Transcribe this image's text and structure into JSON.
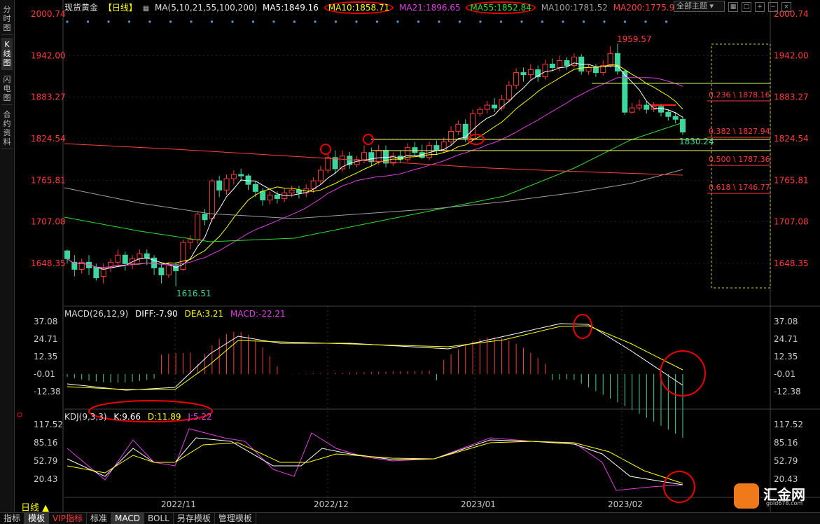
{
  "left_tabs": [
    "分时图",
    "K线图",
    "闪电图",
    "合约资料"
  ],
  "header": {
    "symbol": "现货黄金",
    "period": "【日线】",
    "ma_icon": "chart-icon",
    "ma_spec": "MA(5,10,21,55,100,200)",
    "ma5": "MA5:1849.16",
    "ma10": "MA10:1858.71",
    "ma21": "MA21:1896.65",
    "ma55": "MA55:1852.84",
    "ma100": "MA100:1781.52",
    "ma200": "MA200:1775.95",
    "theme": "全部主题",
    "colors": {
      "ma5": "#ffffff",
      "ma10": "#ffff00",
      "ma21": "#e040e0",
      "ma55": "#30e030",
      "ma100": "#a0a0a0",
      "ma200": "#ff4040"
    }
  },
  "price_axis": [
    "2000.74",
    "1942.00",
    "1883.27",
    "1824.54",
    "1765.81",
    "1707.08",
    "1648.35"
  ],
  "annotations": {
    "high": "1959.57",
    "low": "1616.51",
    "last": "1830.24"
  },
  "fib": [
    {
      "label": "0.236 \\ 1878.16"
    },
    {
      "label": "0.382 \\ 1827.94"
    },
    {
      "label": "0.500 \\ 1787.36"
    },
    {
      "label": "0.618 \\ 1746.77"
    }
  ],
  "macd": {
    "title": "MACD(26,12,9)",
    "diff": "DIFF:-7.90",
    "dea": "DEA:3.21",
    "macd": "MACD:-22.21",
    "axis": [
      "37.08",
      "24.71",
      "12.35",
      "-0.01",
      "-12.38"
    ]
  },
  "kdj": {
    "title": "KDJ(9,3,3)",
    "k": "K:9.66",
    "d": "D:11.89",
    "j": "J:5.22",
    "axis": [
      "117.52",
      "85.16",
      "52.79",
      "20.43"
    ]
  },
  "x_axis": [
    "2022/11",
    "2022/12",
    "2023/01",
    "2023/02"
  ],
  "period_label": "日线 ▲",
  "bottom_tabs": [
    "指标",
    "模板",
    "VIP指标",
    "标准",
    "MACD",
    "BOLL",
    "另存模板",
    "管理模板"
  ],
  "watermark": {
    "name": "汇金网",
    "url": "gold678.com"
  },
  "chart_data": {
    "type": "candlestick",
    "ylim": [
      1600,
      2005
    ],
    "candles": [
      [
        1666,
        1655,
        1668,
        1648
      ],
      [
        1650,
        1640,
        1660,
        1630
      ],
      [
        1640,
        1650,
        1655,
        1634
      ],
      [
        1650,
        1642,
        1660,
        1632
      ],
      [
        1643,
        1628,
        1648,
        1624
      ],
      [
        1630,
        1640,
        1648,
        1620
      ],
      [
        1642,
        1650,
        1655,
        1636
      ],
      [
        1650,
        1660,
        1668,
        1646
      ],
      [
        1660,
        1648,
        1665,
        1638
      ],
      [
        1648,
        1655,
        1660,
        1640
      ],
      [
        1655,
        1662,
        1668,
        1650
      ],
      [
        1662,
        1656,
        1668,
        1646
      ],
      [
        1656,
        1642,
        1660,
        1632
      ],
      [
        1642,
        1632,
        1648,
        1620
      ],
      [
        1632,
        1645,
        1650,
        1628
      ],
      [
        1645,
        1638,
        1650,
        1616
      ],
      [
        1640,
        1678,
        1682,
        1638
      ],
      [
        1678,
        1682,
        1688,
        1668
      ],
      [
        1682,
        1718,
        1722,
        1676
      ],
      [
        1718,
        1710,
        1725,
        1702
      ],
      [
        1712,
        1765,
        1768,
        1708
      ],
      [
        1765,
        1752,
        1772,
        1742
      ],
      [
        1752,
        1768,
        1774,
        1745
      ],
      [
        1768,
        1774,
        1780,
        1760
      ],
      [
        1774,
        1772,
        1782,
        1764
      ],
      [
        1772,
        1760,
        1775,
        1752
      ],
      [
        1760,
        1750,
        1764,
        1742
      ],
      [
        1750,
        1738,
        1755,
        1730
      ],
      [
        1738,
        1745,
        1750,
        1732
      ],
      [
        1745,
        1740,
        1750,
        1733
      ],
      [
        1740,
        1748,
        1754,
        1735
      ],
      [
        1748,
        1752,
        1758,
        1742
      ],
      [
        1752,
        1748,
        1758,
        1740
      ],
      [
        1748,
        1754,
        1760,
        1742
      ],
      [
        1754,
        1765,
        1770,
        1748
      ],
      [
        1765,
        1780,
        1786,
        1760
      ],
      [
        1780,
        1798,
        1804,
        1776
      ],
      [
        1798,
        1782,
        1808,
        1775
      ],
      [
        1782,
        1800,
        1808,
        1778
      ],
      [
        1800,
        1788,
        1806,
        1782
      ],
      [
        1788,
        1795,
        1800,
        1784
      ],
      [
        1795,
        1805,
        1815,
        1790
      ],
      [
        1805,
        1792,
        1812,
        1786
      ],
      [
        1792,
        1808,
        1816,
        1788
      ],
      [
        1808,
        1790,
        1815,
        1784
      ],
      [
        1790,
        1800,
        1805,
        1786
      ],
      [
        1800,
        1795,
        1808,
        1790
      ],
      [
        1795,
        1812,
        1818,
        1792
      ],
      [
        1812,
        1805,
        1820,
        1800
      ],
      [
        1805,
        1798,
        1816,
        1796
      ],
      [
        1798,
        1815,
        1820,
        1794
      ],
      [
        1815,
        1808,
        1822,
        1802
      ],
      [
        1808,
        1820,
        1826,
        1805
      ],
      [
        1820,
        1835,
        1842,
        1815
      ],
      [
        1835,
        1845,
        1850,
        1830
      ],
      [
        1845,
        1825,
        1852,
        1820
      ],
      [
        1825,
        1860,
        1866,
        1822
      ],
      [
        1860,
        1866,
        1870,
        1856
      ],
      [
        1866,
        1872,
        1878,
        1860
      ],
      [
        1872,
        1868,
        1882,
        1862
      ],
      [
        1868,
        1880,
        1886,
        1864
      ],
      [
        1880,
        1900,
        1906,
        1876
      ],
      [
        1900,
        1918,
        1924,
        1895
      ],
      [
        1918,
        1915,
        1925,
        1905
      ],
      [
        1915,
        1922,
        1930,
        1908
      ],
      [
        1922,
        1912,
        1928,
        1905
      ],
      [
        1912,
        1930,
        1936,
        1908
      ],
      [
        1930,
        1925,
        1938,
        1920
      ],
      [
        1925,
        1935,
        1942,
        1920
      ],
      [
        1935,
        1928,
        1940,
        1922
      ],
      [
        1928,
        1940,
        1945,
        1925
      ],
      [
        1940,
        1920,
        1944,
        1915
      ],
      [
        1920,
        1925,
        1930,
        1915
      ],
      [
        1925,
        1918,
        1930,
        1912
      ],
      [
        1918,
        1928,
        1935,
        1914
      ],
      [
        1928,
        1945,
        1955,
        1925
      ],
      [
        1945,
        1920,
        1959,
        1915
      ],
      [
        1920,
        1862,
        1922,
        1858
      ],
      [
        1862,
        1868,
        1875,
        1860
      ],
      [
        1868,
        1872,
        1880,
        1864
      ],
      [
        1872,
        1866,
        1878,
        1860
      ],
      [
        1866,
        1870,
        1876,
        1862
      ],
      [
        1870,
        1862,
        1874,
        1856
      ],
      [
        1862,
        1856,
        1866,
        1850
      ],
      [
        1856,
        1852,
        1862,
        1846
      ],
      [
        1852,
        1834,
        1856,
        1830
      ]
    ]
  }
}
